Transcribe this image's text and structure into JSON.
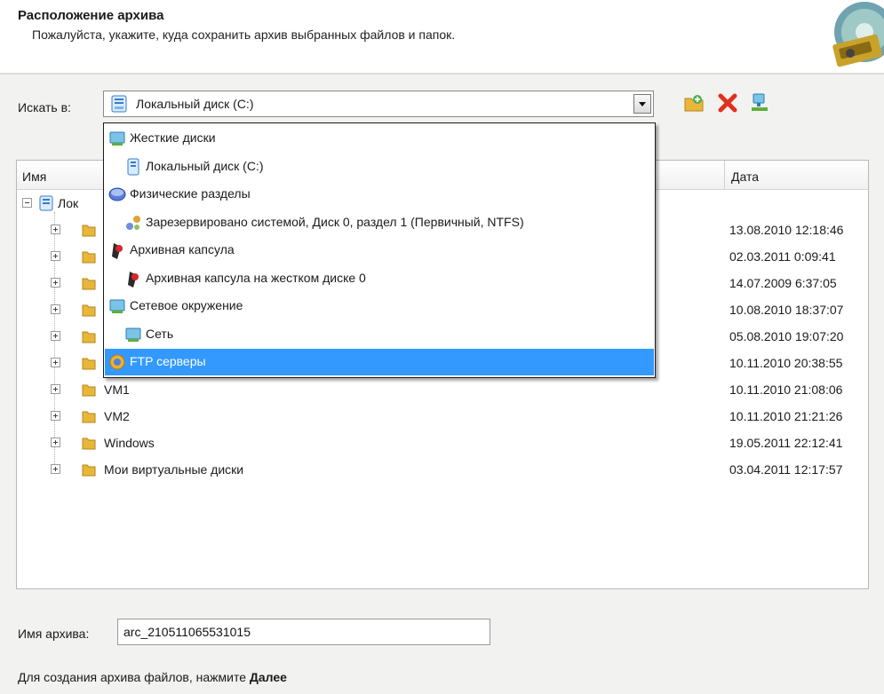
{
  "header": {
    "title": "Расположение архива",
    "subtitle": "Пожалуйста, укажите, куда сохранить архив выбранных файлов и папок."
  },
  "look_in": {
    "label": "Искать в:",
    "selected_value": "Локальный диск (C:)"
  },
  "toolbar": {
    "icons": [
      "new-folder-icon",
      "delete-icon",
      "network-drive-icon"
    ]
  },
  "file_list": {
    "columns": {
      "name": "Имя",
      "date": "Дата"
    },
    "root": {
      "label": "Лок",
      "icon": "local-disk-icon"
    },
    "rows": [
      {
        "name": "",
        "date": "13.08.2010 12:18:46"
      },
      {
        "name": "",
        "date": "02.03.2011 0:09:41"
      },
      {
        "name": "",
        "date": "14.07.2009 6:37:05"
      },
      {
        "name": "",
        "date": "10.08.2010 18:37:07"
      },
      {
        "name": "",
        "date": "05.08.2010 19:07:20"
      },
      {
        "name": "",
        "date": "10.11.2010 20:38:55"
      },
      {
        "name": "VM1",
        "date": "10.11.2010 21:08:06"
      },
      {
        "name": "VM2",
        "date": "10.11.2010 21:21:26"
      },
      {
        "name": "Windows",
        "date": "19.05.2011 22:12:41"
      },
      {
        "name": "Мои виртуальные диски",
        "date": "03.04.2011 12:17:57"
      }
    ]
  },
  "dropdown": {
    "items": [
      {
        "label": "Жесткие диски",
        "icon": "hard-disks-icon",
        "indent": 0
      },
      {
        "label": "Локальный диск (C:)",
        "icon": "local-disk-icon",
        "indent": 1
      },
      {
        "label": "Физические разделы",
        "icon": "physical-partitions-icon",
        "indent": 0
      },
      {
        "label": "Зарезервировано системой, Диск 0, раздел 1 (Первичный, NTFS)",
        "icon": "partition-icon",
        "indent": 1
      },
      {
        "label": "Архивная капсула",
        "icon": "archive-capsule-icon",
        "indent": 0
      },
      {
        "label": "Архивная капсула на жестком диске 0",
        "icon": "archive-capsule-icon",
        "indent": 1
      },
      {
        "label": "Сетевое окружение",
        "icon": "network-neighborhood-icon",
        "indent": 0
      },
      {
        "label": "Сеть",
        "icon": "network-icon",
        "indent": 1
      },
      {
        "label": "FTP серверы",
        "icon": "ftp-servers-icon",
        "indent": 0,
        "selected": true
      }
    ]
  },
  "archive_name": {
    "label": "Имя архива:",
    "value": "arc_210511065531015"
  },
  "hint": {
    "text": "Для создания архива файлов, нажмите ",
    "bold": "Далее"
  },
  "colors": {
    "selection": "#3399ff",
    "folder": "#e8b73a",
    "panel_bg": "#f2f2f0"
  }
}
